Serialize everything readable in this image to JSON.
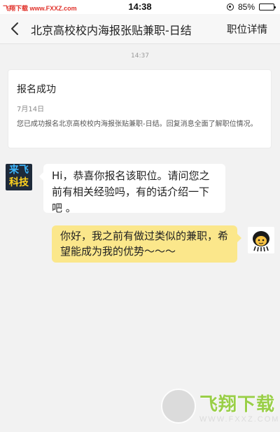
{
  "status_bar": {
    "watermark": "飞翔下载 www.FXXZ.com",
    "time": "14:38",
    "battery": "85%",
    "battery_level": 0.85
  },
  "nav": {
    "back_icon": "chevron-left-icon",
    "title": "北京高校校内海报张贴兼职-日结",
    "action": "职位详情"
  },
  "chat": {
    "timestamp": "14:37",
    "notice": {
      "title": "报名成功",
      "date": "7月14日",
      "body": "您已成功报名北京高校校内海报张贴兼职-日结。回复消息全面了解职位情况。"
    },
    "messages": [
      {
        "sender": "company",
        "avatar_lines": [
          "来飞",
          "科技"
        ],
        "text": "Hi，恭喜你报名该职位。请问您之前有相关经验吗，有的话介绍一下吧 。"
      },
      {
        "sender": "user",
        "avatar_icon": "cartoon-avatar-icon",
        "text": "你好，我之前有做过类似的兼职，希望能成为我的优势～～～"
      }
    ]
  },
  "watermark": {
    "title": "飞翔下载",
    "url": "WWW.FXXZ.COM"
  }
}
